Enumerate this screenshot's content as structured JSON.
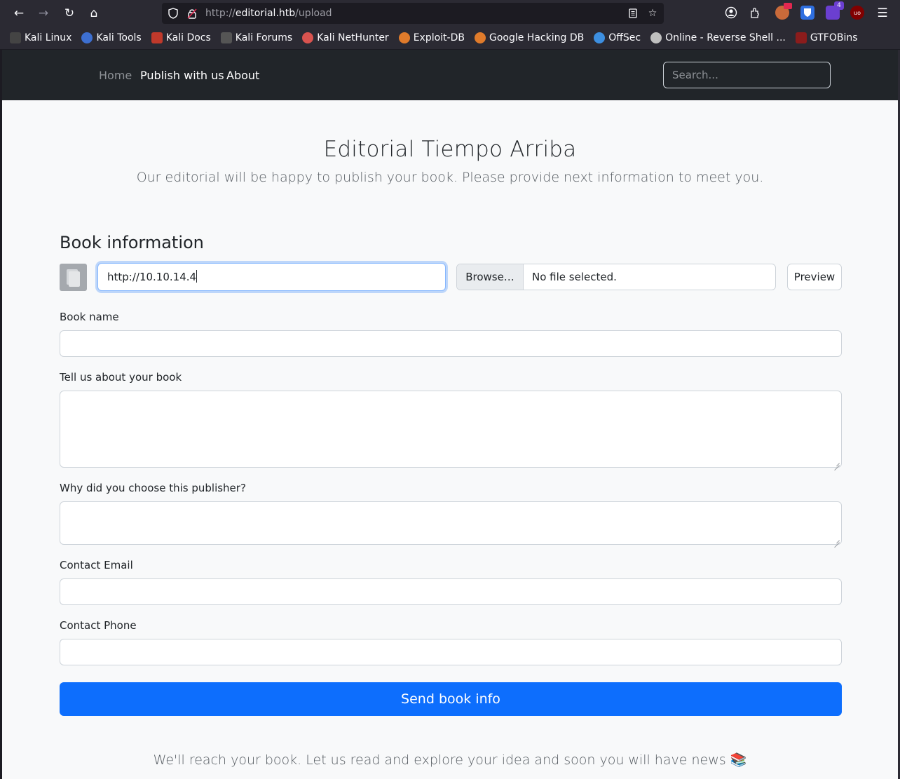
{
  "browser": {
    "url_prefix": "http://",
    "url_host": "editorial.htb",
    "url_path": "/upload",
    "extension_badge": "4",
    "bookmarks": [
      {
        "label": "Kali Linux",
        "color": "#3d8fe0"
      },
      {
        "label": "Kali Tools",
        "color": "#d9534f"
      },
      {
        "label": "Kali Docs",
        "color": "#c0392b"
      },
      {
        "label": "Kali Forums",
        "color": "#3d8fe0"
      },
      {
        "label": "Kali NetHunter",
        "color": "#d9534f"
      },
      {
        "label": "Exploit-DB",
        "color": "#e07b2b"
      },
      {
        "label": "Google Hacking DB",
        "color": "#e07b2b"
      },
      {
        "label": "OffSec",
        "color": "#3d8fe0"
      },
      {
        "label": "Online - Reverse Shell ...",
        "color": "#bfbfbf"
      },
      {
        "label": "GTFOBins",
        "color": "#8b1c1c"
      }
    ]
  },
  "site_nav": {
    "home": "Home",
    "publish": "Publish with us",
    "about": "About",
    "search_placeholder": "Search..."
  },
  "hero": {
    "title": "Editorial Tiempo Arriba",
    "subtitle": "Our editorial will be happy to publish your book. Please provide next information to meet you."
  },
  "form": {
    "section_title": "Book information",
    "cover_url_value": "http://10.10.14.4",
    "browse_label": "Browse…",
    "file_status": "No file selected.",
    "preview_label": "Preview",
    "book_name_label": "Book name",
    "about_label": "Tell us about your book",
    "why_label": "Why did you choose this publisher?",
    "email_label": "Contact Email",
    "phone_label": "Contact Phone",
    "submit_label": "Send book info"
  },
  "footer": {
    "text": "We'll reach your book. Let us read and explore your idea and soon you will have news 📚"
  },
  "colors": {
    "primary": "#0d6efd",
    "navbar": "#212529",
    "page_bg": "#f8f9fa"
  }
}
